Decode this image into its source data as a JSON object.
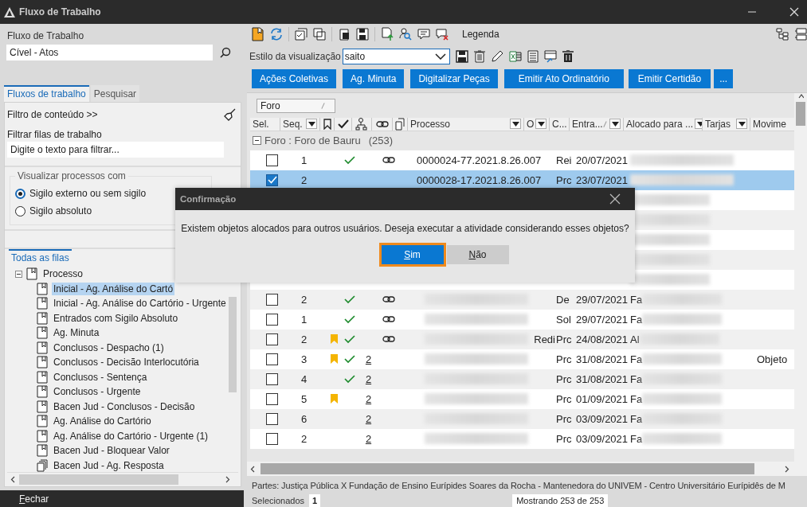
{
  "window": {
    "title": "Fluxo de Trabalho"
  },
  "left": {
    "workflow_label": "Fluxo de Trabalho",
    "workflow_value": "Cível - Atos",
    "tabs": [
      {
        "label": "Fluxos de trabalho",
        "selected": true
      },
      {
        "label": "Pesquisar",
        "selected": false
      }
    ],
    "content_filter": "Filtro de conteúdo >>",
    "queue_filter_label": "Filtrar filas de trabalho",
    "queue_filter_placeholder": "Digite o texto para filtrar...",
    "visibility": {
      "title": "Visualizar processos com",
      "options": [
        {
          "label": "Sigilo externo ou sem sigilo",
          "selected": true
        },
        {
          "label": "Sigilo absoluto",
          "selected": false
        }
      ]
    },
    "queues_tab": "Todas as filas",
    "tree": [
      {
        "label": "Processo",
        "kind": "queue",
        "expanded": true,
        "selected": false,
        "children": [
          {
            "label": "Inicial - Ag. Análise do Cartó",
            "kind": "queue",
            "selected": true
          },
          {
            "label": "Inicial - Ag. Análise do Cartório - Urgente",
            "kind": "queue",
            "selected": false
          },
          {
            "label": "Entrados com Sigilo Absoluto",
            "kind": "queue",
            "selected": false
          },
          {
            "label": "Ag. Minuta",
            "kind": "queue",
            "selected": false
          },
          {
            "label": "Conclusos - Despacho (1)",
            "kind": "queue",
            "selected": false
          },
          {
            "label": "Conclusos - Decisão Interlocutória",
            "kind": "queue",
            "selected": false
          },
          {
            "label": "Conclusos - Sentença",
            "kind": "queue",
            "selected": false
          },
          {
            "label": "Conclusos - Urgente",
            "kind": "queue",
            "selected": false
          },
          {
            "label": "Bacen Jud - Conclusos - Decisão",
            "kind": "queue",
            "selected": false
          },
          {
            "label": "Ag. Análise do Cartório",
            "kind": "queue",
            "selected": false
          },
          {
            "label": "Ag. Análise do Cartório - Urgente (1)",
            "kind": "queue",
            "selected": false
          },
          {
            "label": "Bacen Jud - Bloquear Valor",
            "kind": "queue",
            "selected": false
          },
          {
            "label": "Bacen Jud - Ag. Resposta",
            "kind": "stack",
            "selected": false
          }
        ]
      }
    ],
    "close_button": "Fechar"
  },
  "toolbar": {
    "legend": "Legenda",
    "style_label": "Estilo da visualização",
    "style_value": "saito"
  },
  "actions": [
    "Ações Coletivas",
    "Ag. Minuta",
    "Digitalizar Peças",
    "Emitir Ato Ordinatório",
    "Emitir Certidão",
    "..."
  ],
  "grid": {
    "group_by": {
      "label": "Foro",
      "sorted": true
    },
    "columns": [
      {
        "label": "Sel.",
        "filter": false,
        "sorted": false
      },
      {
        "label": "Seq.",
        "filter": true,
        "sorted": false
      },
      {
        "label": "Processo",
        "filter": true,
        "sorted": false
      },
      {
        "label": "O",
        "filter": true,
        "sorted": false
      },
      {
        "label": "C..."
      },
      {
        "label": "Entra...",
        "filter": true,
        "sorted": true
      },
      {
        "label": "Alocado para ...",
        "filter": true,
        "sorted": false
      },
      {
        "label": "Tarjas",
        "filter": true,
        "sorted": false
      },
      {
        "label": "Movime",
        "filter": false,
        "sorted": false
      }
    ],
    "group": {
      "label": "Foro : Foro de Bauru",
      "count": "(253)",
      "expanded": true
    },
    "rows": [
      {
        "kind": "row",
        "checked": false,
        "selected": false,
        "seq": "1",
        "flag": false,
        "done": true,
        "link": true,
        "process": "0000024-77.2021.8.26.007",
        "c": "Rei",
        "date": "20/07/2021"
      },
      {
        "kind": "row",
        "checked": true,
        "selected": true,
        "seq": "2",
        "flag": false,
        "done": false,
        "link": false,
        "process": "0000028-17.2021.8.26.007",
        "c": "Prc",
        "date": "23/07/2021"
      },
      {
        "kind": "covered"
      },
      {
        "kind": "covered"
      },
      {
        "kind": "covered"
      },
      {
        "kind": "covered"
      },
      {
        "kind": "covered"
      },
      {
        "kind": "row",
        "checked": false,
        "selected": false,
        "seq": "2",
        "flag": false,
        "done": true,
        "link": true,
        "c": "De",
        "date": "29/07/2021",
        "allocated": "Fa"
      },
      {
        "kind": "row",
        "checked": false,
        "selected": false,
        "seq": "1",
        "flag": false,
        "done": true,
        "link": true,
        "c": "Sol",
        "date": "29/07/2021",
        "allocated": "Fa"
      },
      {
        "kind": "row",
        "checked": false,
        "selected": false,
        "seq": "2",
        "flag": true,
        "done": true,
        "link": true,
        "o": "Redi",
        "c": "Prc",
        "date": "24/08/2021",
        "allocated": "Al"
      },
      {
        "kind": "row",
        "checked": false,
        "selected": false,
        "seq": "3",
        "flag": true,
        "done": true,
        "link": false,
        "count": "2",
        "c": "Prc",
        "date": "31/08/2021",
        "allocated": "Fa",
        "movement": "Objeto"
      },
      {
        "kind": "row",
        "checked": false,
        "selected": false,
        "seq": "4",
        "flag": false,
        "done": true,
        "link": false,
        "count": "2",
        "c": "Prc",
        "date": "31/08/2021",
        "allocated": "Fa"
      },
      {
        "kind": "row",
        "checked": false,
        "selected": false,
        "seq": "5",
        "flag": true,
        "done": false,
        "link": false,
        "count": "2",
        "c": "Prc",
        "date": "01/09/2021",
        "allocated": "Fa"
      },
      {
        "kind": "row",
        "checked": false,
        "selected": false,
        "seq": "6",
        "flag": false,
        "done": false,
        "link": false,
        "count": "2",
        "c": "Prc",
        "date": "03/09/2021",
        "allocated": "Fa"
      },
      {
        "kind": "row",
        "checked": false,
        "selected": false,
        "seq": "2",
        "flag": false,
        "done": false,
        "link": false,
        "count": "2",
        "c": "Prc",
        "date": "03/09/2021",
        "allocated": "Fa"
      }
    ]
  },
  "status": {
    "parties": "Partes: Justiça Pública  X  Fundação de Ensino Eurípides Soares da Rocha - Mantenedora do UNIVEM - Centro Universitário Eurípidês de M",
    "selected_label": "Selecionados",
    "selected_count": "1",
    "showing": "Mostrando 253 de 253"
  },
  "dialog": {
    "title": "Confirmação",
    "message": "Existem objetos alocados para outros usuários. Deseja executar a atividade considerando esses objetos?",
    "buttons": [
      {
        "label": "Sim",
        "focused": true
      },
      {
        "label": "Não",
        "focused": false
      }
    ]
  }
}
